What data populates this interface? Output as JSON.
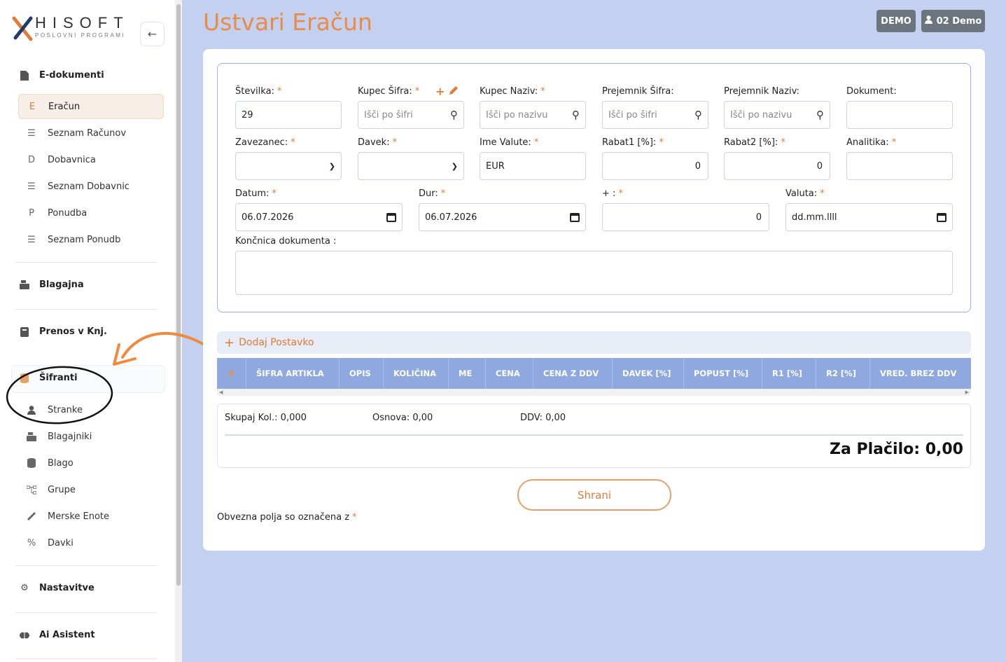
{
  "brand": {
    "name": "HISOFT",
    "tagline": "POSLOVNI PROGRAMI"
  },
  "sidebar": {
    "sections": [
      {
        "label": "E-dokumenti",
        "icon": "file-icon"
      },
      {
        "label": "Blagajna",
        "icon": "cash-register-icon"
      },
      {
        "label": "Prenos v Knj.",
        "icon": "book-icon"
      },
      {
        "label": "Šifranti",
        "icon": "database-icon"
      },
      {
        "label": "Nastavitve",
        "icon": "gear-icon"
      },
      {
        "label": "Ai Asistent",
        "icon": "brain-icon"
      }
    ],
    "edoc_items": [
      {
        "label": "Eračun",
        "icon": "E"
      },
      {
        "label": "Seznam Računov",
        "icon": "list-icon"
      },
      {
        "label": "Dobavnica",
        "icon": "D"
      },
      {
        "label": "Seznam Dobavnic",
        "icon": "list-icon"
      },
      {
        "label": "Ponudba",
        "icon": "P"
      },
      {
        "label": "Seznam Ponudb",
        "icon": "list-icon"
      }
    ],
    "sifranti_items": [
      {
        "label": "Stranke",
        "icon": "user-icon"
      },
      {
        "label": "Blagajniki",
        "icon": "cash-register-icon"
      },
      {
        "label": "Blago",
        "icon": "database-icon"
      },
      {
        "label": "Grupe",
        "icon": "sitemap-icon"
      },
      {
        "label": "Merske Enote",
        "icon": "ruler-icon"
      },
      {
        "label": "Davki",
        "icon": "percent-icon"
      }
    ]
  },
  "header": {
    "title": "Ustvari Eračun",
    "demo_badge": "DEMO",
    "user_badge": "02 Demo"
  },
  "form": {
    "stevilka": {
      "label": "Številka:",
      "value": "29"
    },
    "kupec_sifra": {
      "label": "Kupec Šifra:",
      "placeholder": "Išči po šifri"
    },
    "kupec_naziv": {
      "label": "Kupec Naziv:",
      "placeholder": "Išči po nazivu"
    },
    "prejemnik_sifra": {
      "label": "Prejemnik Šifra:",
      "placeholder": "Išči po šifri"
    },
    "prejemnik_naziv": {
      "label": "Prejemnik Naziv:",
      "placeholder": "Išči po nazivu"
    },
    "dokument": {
      "label": "Dokument:",
      "value": ""
    },
    "zavezanec": {
      "label": "Zavezanec:",
      "value": ""
    },
    "davek": {
      "label": "Davek:",
      "value": ""
    },
    "ime_valute": {
      "label": "Ime Valute:",
      "value": "EUR"
    },
    "rabat1": {
      "label": "Rabat1 [%]:",
      "value": "0"
    },
    "rabat2": {
      "label": "Rabat2 [%]:",
      "value": "0"
    },
    "analitika": {
      "label": "Analitika:",
      "value": ""
    },
    "datum": {
      "label": "Datum:",
      "value": "06.07.2026"
    },
    "dur": {
      "label": "Dur:",
      "value": "06.07.2026"
    },
    "plus": {
      "label": "+ :",
      "value": "0"
    },
    "valuta": {
      "label": "Valuta:",
      "value": "dd.mm.llll"
    },
    "koncnica": {
      "label": "Končnica dokumenta :",
      "value": ""
    },
    "required_mark": "*"
  },
  "items": {
    "add_label": "Dodaj Postavko",
    "columns": [
      "#",
      "ŠIFRA ARTIKLA",
      "OPIS",
      "KOLIČINA",
      "ME",
      "CENA",
      "CENA Z DDV",
      "DAVEK [%]",
      "POPUST [%]",
      "R1 [%]",
      "R2 [%]",
      "VRED. BREZ DDV"
    ]
  },
  "totals": {
    "skupaj_kol": "Skupaj Kol.: 0,000",
    "osnova": "Osnova: 0,00",
    "ddv": "DDV: 0,00",
    "za_placilo": "Za Plačilo: 0,00"
  },
  "actions": {
    "save": "Shrani"
  },
  "note": "Obvezna polja so označena z",
  "colors": {
    "accent": "#e07b3a",
    "page_bg": "#c3d0ef",
    "table_header": "#8fa9e0",
    "badge": "#6c757d"
  }
}
